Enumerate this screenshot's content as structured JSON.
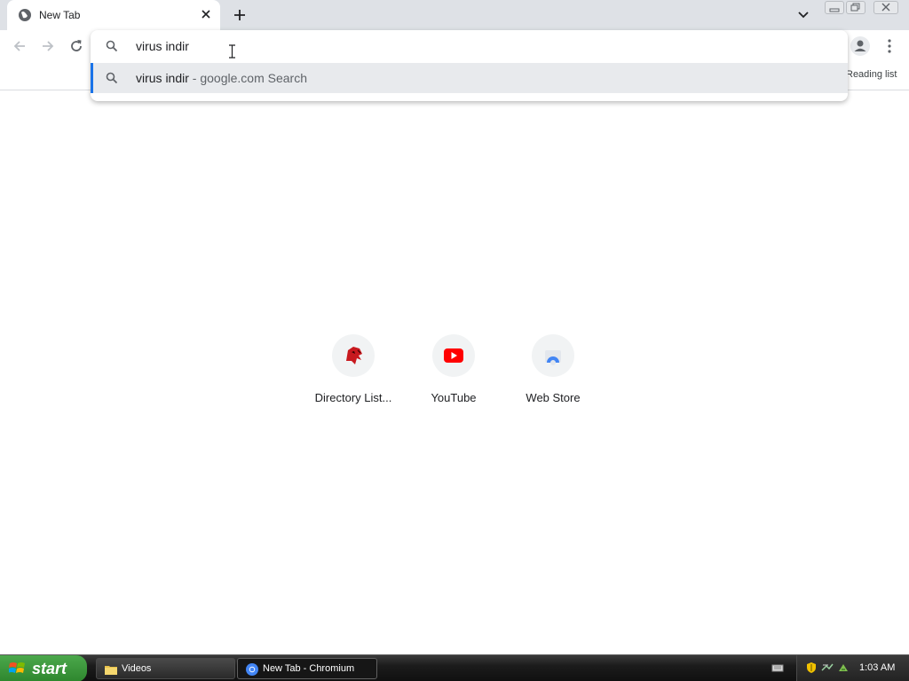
{
  "browser": {
    "tab": {
      "title": "New Tab"
    },
    "omnibox": {
      "text": "virus indir",
      "suggestion": {
        "query": "virus indir",
        "suffix": " - google.com Search"
      }
    },
    "reading_list_label": "Reading list",
    "icons": {
      "tab_favicon": "globe-icon",
      "tab_close": "close-icon",
      "new_tab": "plus-icon",
      "tab_search": "chevron-down-icon",
      "back": "arrow-left-icon",
      "forward": "arrow-right-icon",
      "reload": "reload-icon",
      "search": "search-icon",
      "profile": "profile-icon",
      "menu": "kebab-menu-icon"
    },
    "accent_color": "#1a73e8"
  },
  "shortcuts": [
    {
      "label": "Directory List...",
      "icon": "red-dragon-icon"
    },
    {
      "label": "YouTube",
      "icon": "youtube-icon"
    },
    {
      "label": "Web Store",
      "icon": "web-store-icon"
    }
  ],
  "taskbar": {
    "start_label": "start",
    "items": [
      {
        "label": "Videos",
        "icon": "folder-icon",
        "active": false
      },
      {
        "label": "New Tab - Chromium",
        "icon": "chromium-icon",
        "active": true
      }
    ],
    "clock": "1:03 AM"
  }
}
